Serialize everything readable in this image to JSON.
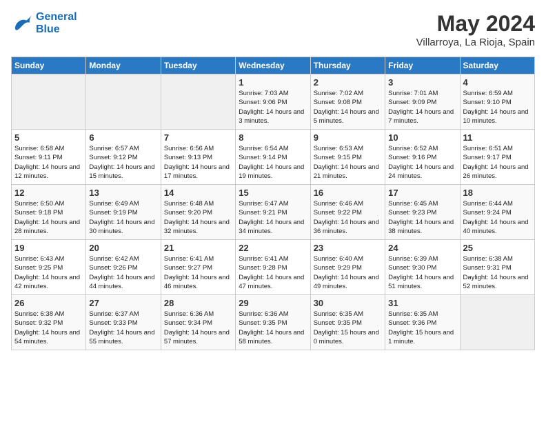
{
  "header": {
    "logo_line1": "General",
    "logo_line2": "Blue",
    "month": "May 2024",
    "location": "Villarroya, La Rioja, Spain"
  },
  "weekdays": [
    "Sunday",
    "Monday",
    "Tuesday",
    "Wednesday",
    "Thursday",
    "Friday",
    "Saturday"
  ],
  "weeks": [
    [
      {
        "day": "",
        "info": ""
      },
      {
        "day": "",
        "info": ""
      },
      {
        "day": "",
        "info": ""
      },
      {
        "day": "1",
        "info": "Sunrise: 7:03 AM\nSunset: 9:06 PM\nDaylight: 14 hours\nand 3 minutes."
      },
      {
        "day": "2",
        "info": "Sunrise: 7:02 AM\nSunset: 9:08 PM\nDaylight: 14 hours\nand 5 minutes."
      },
      {
        "day": "3",
        "info": "Sunrise: 7:01 AM\nSunset: 9:09 PM\nDaylight: 14 hours\nand 7 minutes."
      },
      {
        "day": "4",
        "info": "Sunrise: 6:59 AM\nSunset: 9:10 PM\nDaylight: 14 hours\nand 10 minutes."
      }
    ],
    [
      {
        "day": "5",
        "info": "Sunrise: 6:58 AM\nSunset: 9:11 PM\nDaylight: 14 hours\nand 12 minutes."
      },
      {
        "day": "6",
        "info": "Sunrise: 6:57 AM\nSunset: 9:12 PM\nDaylight: 14 hours\nand 15 minutes."
      },
      {
        "day": "7",
        "info": "Sunrise: 6:56 AM\nSunset: 9:13 PM\nDaylight: 14 hours\nand 17 minutes."
      },
      {
        "day": "8",
        "info": "Sunrise: 6:54 AM\nSunset: 9:14 PM\nDaylight: 14 hours\nand 19 minutes."
      },
      {
        "day": "9",
        "info": "Sunrise: 6:53 AM\nSunset: 9:15 PM\nDaylight: 14 hours\nand 21 minutes."
      },
      {
        "day": "10",
        "info": "Sunrise: 6:52 AM\nSunset: 9:16 PM\nDaylight: 14 hours\nand 24 minutes."
      },
      {
        "day": "11",
        "info": "Sunrise: 6:51 AM\nSunset: 9:17 PM\nDaylight: 14 hours\nand 26 minutes."
      }
    ],
    [
      {
        "day": "12",
        "info": "Sunrise: 6:50 AM\nSunset: 9:18 PM\nDaylight: 14 hours\nand 28 minutes."
      },
      {
        "day": "13",
        "info": "Sunrise: 6:49 AM\nSunset: 9:19 PM\nDaylight: 14 hours\nand 30 minutes."
      },
      {
        "day": "14",
        "info": "Sunrise: 6:48 AM\nSunset: 9:20 PM\nDaylight: 14 hours\nand 32 minutes."
      },
      {
        "day": "15",
        "info": "Sunrise: 6:47 AM\nSunset: 9:21 PM\nDaylight: 14 hours\nand 34 minutes."
      },
      {
        "day": "16",
        "info": "Sunrise: 6:46 AM\nSunset: 9:22 PM\nDaylight: 14 hours\nand 36 minutes."
      },
      {
        "day": "17",
        "info": "Sunrise: 6:45 AM\nSunset: 9:23 PM\nDaylight: 14 hours\nand 38 minutes."
      },
      {
        "day": "18",
        "info": "Sunrise: 6:44 AM\nSunset: 9:24 PM\nDaylight: 14 hours\nand 40 minutes."
      }
    ],
    [
      {
        "day": "19",
        "info": "Sunrise: 6:43 AM\nSunset: 9:25 PM\nDaylight: 14 hours\nand 42 minutes."
      },
      {
        "day": "20",
        "info": "Sunrise: 6:42 AM\nSunset: 9:26 PM\nDaylight: 14 hours\nand 44 minutes."
      },
      {
        "day": "21",
        "info": "Sunrise: 6:41 AM\nSunset: 9:27 PM\nDaylight: 14 hours\nand 46 minutes."
      },
      {
        "day": "22",
        "info": "Sunrise: 6:41 AM\nSunset: 9:28 PM\nDaylight: 14 hours\nand 47 minutes."
      },
      {
        "day": "23",
        "info": "Sunrise: 6:40 AM\nSunset: 9:29 PM\nDaylight: 14 hours\nand 49 minutes."
      },
      {
        "day": "24",
        "info": "Sunrise: 6:39 AM\nSunset: 9:30 PM\nDaylight: 14 hours\nand 51 minutes."
      },
      {
        "day": "25",
        "info": "Sunrise: 6:38 AM\nSunset: 9:31 PM\nDaylight: 14 hours\nand 52 minutes."
      }
    ],
    [
      {
        "day": "26",
        "info": "Sunrise: 6:38 AM\nSunset: 9:32 PM\nDaylight: 14 hours\nand 54 minutes."
      },
      {
        "day": "27",
        "info": "Sunrise: 6:37 AM\nSunset: 9:33 PM\nDaylight: 14 hours\nand 55 minutes."
      },
      {
        "day": "28",
        "info": "Sunrise: 6:36 AM\nSunset: 9:34 PM\nDaylight: 14 hours\nand 57 minutes."
      },
      {
        "day": "29",
        "info": "Sunrise: 6:36 AM\nSunset: 9:35 PM\nDaylight: 14 hours\nand 58 minutes."
      },
      {
        "day": "30",
        "info": "Sunrise: 6:35 AM\nSunset: 9:35 PM\nDaylight: 15 hours\nand 0 minutes."
      },
      {
        "day": "31",
        "info": "Sunrise: 6:35 AM\nSunset: 9:36 PM\nDaylight: 15 hours\nand 1 minute."
      },
      {
        "day": "",
        "info": ""
      }
    ]
  ]
}
